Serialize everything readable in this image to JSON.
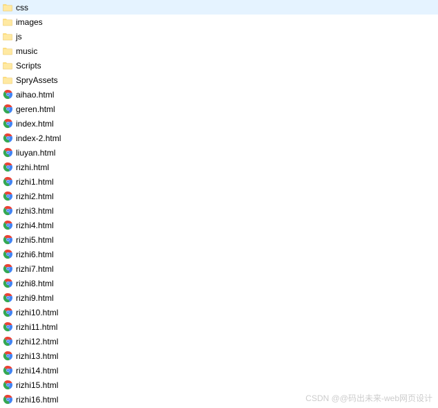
{
  "files": [
    {
      "name": "css",
      "type": "folder"
    },
    {
      "name": "images",
      "type": "folder"
    },
    {
      "name": "js",
      "type": "folder"
    },
    {
      "name": "music",
      "type": "folder"
    },
    {
      "name": "Scripts",
      "type": "folder"
    },
    {
      "name": "SpryAssets",
      "type": "folder"
    },
    {
      "name": "aihao.html",
      "type": "html"
    },
    {
      "name": "geren.html",
      "type": "html"
    },
    {
      "name": "index.html",
      "type": "html"
    },
    {
      "name": "index-2.html",
      "type": "html"
    },
    {
      "name": "liuyan.html",
      "type": "html"
    },
    {
      "name": "rizhi.html",
      "type": "html"
    },
    {
      "name": "rizhi1.html",
      "type": "html"
    },
    {
      "name": "rizhi2.html",
      "type": "html"
    },
    {
      "name": "rizhi3.html",
      "type": "html"
    },
    {
      "name": "rizhi4.html",
      "type": "html"
    },
    {
      "name": "rizhi5.html",
      "type": "html"
    },
    {
      "name": "rizhi6.html",
      "type": "html"
    },
    {
      "name": "rizhi7.html",
      "type": "html"
    },
    {
      "name": "rizhi8.html",
      "type": "html"
    },
    {
      "name": "rizhi9.html",
      "type": "html"
    },
    {
      "name": "rizhi10.html",
      "type": "html"
    },
    {
      "name": "rizhi11.html",
      "type": "html"
    },
    {
      "name": "rizhi12.html",
      "type": "html"
    },
    {
      "name": "rizhi13.html",
      "type": "html"
    },
    {
      "name": "rizhi14.html",
      "type": "html"
    },
    {
      "name": "rizhi15.html",
      "type": "html"
    },
    {
      "name": "rizhi16.html",
      "type": "html"
    }
  ],
  "watermark": "CSDN @@码出未来-web网页设计"
}
